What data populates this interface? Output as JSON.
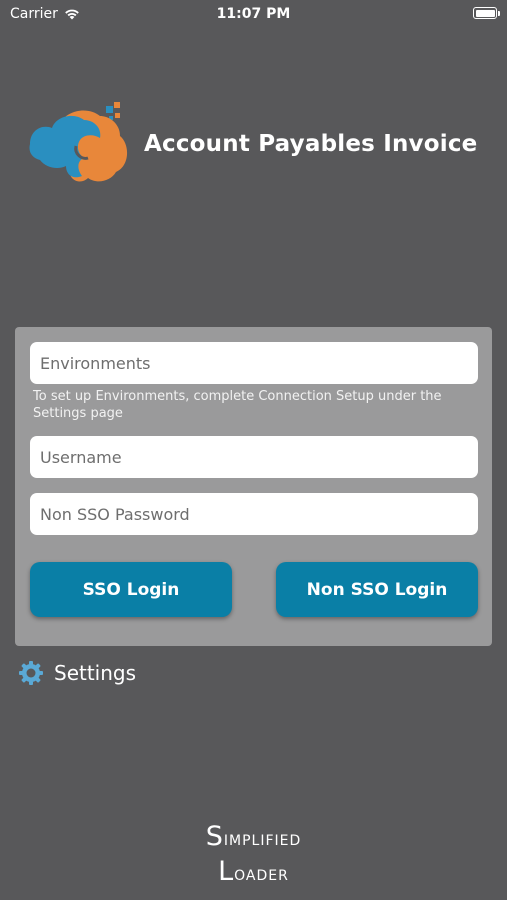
{
  "status_bar": {
    "carrier": "Carrier",
    "time": "11:07 PM"
  },
  "header": {
    "title": "Account Payables Invoice",
    "logo_icon": "cloud-logo-icon"
  },
  "login": {
    "environments_placeholder": "Environments",
    "hint": "To set up Environments, complete Connection Setup under the Settings page",
    "username_placeholder": "Username",
    "password_placeholder": "Non SSO Password",
    "sso_button": "SSO Login",
    "non_sso_button": "Non SSO Login"
  },
  "settings": {
    "label": "Settings",
    "icon": "gear-icon"
  },
  "brand": {
    "line1": "Simplified",
    "line2": "Loader"
  },
  "colors": {
    "background": "#58585a",
    "card": "#9a9a9b",
    "button": "#0a7fa6",
    "logo_blue": "#2a8fc0",
    "logo_orange": "#e8873a"
  }
}
